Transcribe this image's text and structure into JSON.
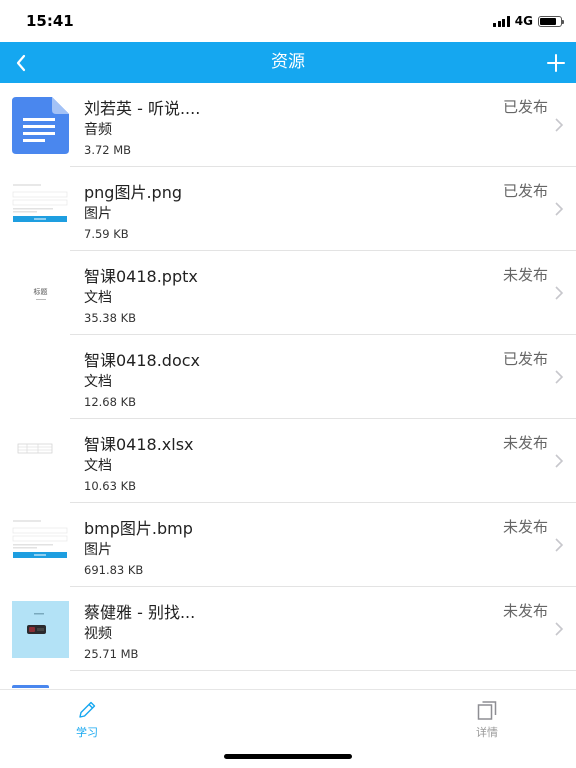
{
  "status_bar": {
    "time": "15:41",
    "network": "4G",
    "battery_level": 0.8
  },
  "nav": {
    "title": "资源",
    "back_icon": "chevron-left-icon",
    "add_icon": "plus-icon"
  },
  "resources": [
    {
      "title": "刘若英 - 听说....",
      "type": "音频",
      "size": "3.72 MB",
      "status": "已发布",
      "thumb": "doc-icon"
    },
    {
      "title": "png图片.png",
      "type": "图片",
      "size": "7.59 KB",
      "status": "已发布",
      "thumb": "form-preview"
    },
    {
      "title": "智课0418.pptx",
      "type": "文档",
      "size": "35.38 KB",
      "status": "未发布",
      "thumb": "slide-preview",
      "thumb_text": "标题"
    },
    {
      "title": "智课0418.docx",
      "type": "文档",
      "size": "12.68 KB",
      "status": "已发布",
      "thumb": "blank"
    },
    {
      "title": "智课0418.xlsx",
      "type": "文档",
      "size": "10.63 KB",
      "status": "未发布",
      "thumb": "sheet-preview"
    },
    {
      "title": "bmp图片.bmp",
      "type": "图片",
      "size": "691.83 KB",
      "status": "未发布",
      "thumb": "form-preview"
    },
    {
      "title": "蔡健雅 - 别找...",
      "type": "视频",
      "size": "25.71 MB",
      "status": "未发布",
      "thumb": "video-preview"
    }
  ],
  "colors": {
    "accent": "#15a7f0",
    "status_text": "#666666",
    "divider": "#e3e3e3"
  },
  "tabs": [
    {
      "label": "学习",
      "icon": "pencil-icon",
      "active": true
    },
    {
      "label": "详情",
      "icon": "copy-icon",
      "active": false
    }
  ]
}
